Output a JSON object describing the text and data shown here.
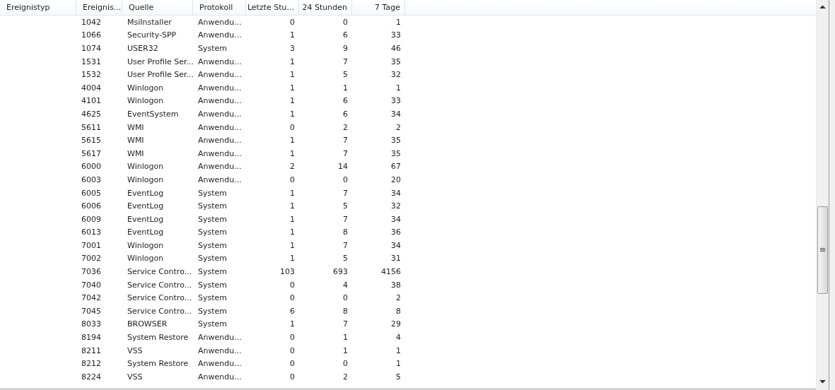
{
  "table": {
    "columns": [
      {
        "label": "Ereignistyp",
        "kind": "text"
      },
      {
        "label": "Ereignis...",
        "kind": "text"
      },
      {
        "label": "Quelle",
        "kind": "text"
      },
      {
        "label": "Protokoll",
        "kind": "text"
      },
      {
        "label": "Letzte Stu...",
        "kind": "number"
      },
      {
        "label": "24 Stunden",
        "kind": "number"
      },
      {
        "label": "7 Tage",
        "kind": "number"
      }
    ],
    "rows": [
      [
        "",
        "1042",
        "MsiInstaller",
        "Anwendu...",
        "0",
        "0",
        "1"
      ],
      [
        "",
        "1066",
        "Security-SPP",
        "Anwendu...",
        "1",
        "6",
        "33"
      ],
      [
        "",
        "1074",
        "USER32",
        "System",
        "3",
        "9",
        "46"
      ],
      [
        "",
        "1531",
        "User Profile Ser...",
        "Anwendu...",
        "1",
        "7",
        "35"
      ],
      [
        "",
        "1532",
        "User Profile Ser...",
        "Anwendu...",
        "1",
        "5",
        "32"
      ],
      [
        "",
        "4004",
        "Winlogon",
        "Anwendu...",
        "1",
        "1",
        "1"
      ],
      [
        "",
        "4101",
        "Winlogon",
        "Anwendu...",
        "1",
        "6",
        "33"
      ],
      [
        "",
        "4625",
        "EventSystem",
        "Anwendu...",
        "1",
        "6",
        "34"
      ],
      [
        "",
        "5611",
        "WMI",
        "Anwendu...",
        "0",
        "2",
        "2"
      ],
      [
        "",
        "5615",
        "WMI",
        "Anwendu...",
        "1",
        "7",
        "35"
      ],
      [
        "",
        "5617",
        "WMI",
        "Anwendu...",
        "1",
        "7",
        "35"
      ],
      [
        "",
        "6000",
        "Winlogon",
        "Anwendu...",
        "2",
        "14",
        "67"
      ],
      [
        "",
        "6003",
        "Winlogon",
        "Anwendu...",
        "0",
        "0",
        "20"
      ],
      [
        "",
        "6005",
        "EventLog",
        "System",
        "1",
        "7",
        "34"
      ],
      [
        "",
        "6006",
        "EventLog",
        "System",
        "1",
        "5",
        "32"
      ],
      [
        "",
        "6009",
        "EventLog",
        "System",
        "1",
        "7",
        "34"
      ],
      [
        "",
        "6013",
        "EventLog",
        "System",
        "1",
        "8",
        "36"
      ],
      [
        "",
        "7001",
        "Winlogon",
        "System",
        "1",
        "7",
        "34"
      ],
      [
        "",
        "7002",
        "Winlogon",
        "System",
        "1",
        "5",
        "31"
      ],
      [
        "",
        "7036",
        "Service Contro...",
        "System",
        "103",
        "693",
        "4156"
      ],
      [
        "",
        "7040",
        "Service Contro...",
        "System",
        "0",
        "4",
        "38"
      ],
      [
        "",
        "7042",
        "Service Contro...",
        "System",
        "0",
        "0",
        "2"
      ],
      [
        "",
        "7045",
        "Service Contro...",
        "System",
        "6",
        "8",
        "8"
      ],
      [
        "",
        "8033",
        "BROWSER",
        "System",
        "1",
        "7",
        "29"
      ],
      [
        "",
        "8194",
        "System Restore",
        "Anwendu...",
        "0",
        "1",
        "4"
      ],
      [
        "",
        "8211",
        "VSS",
        "Anwendu...",
        "0",
        "1",
        "1"
      ],
      [
        "",
        "8212",
        "System Restore",
        "Anwendu...",
        "0",
        "0",
        "1"
      ],
      [
        "",
        "8224",
        "VSS",
        "Anwendu...",
        "0",
        "2",
        "5"
      ]
    ]
  }
}
